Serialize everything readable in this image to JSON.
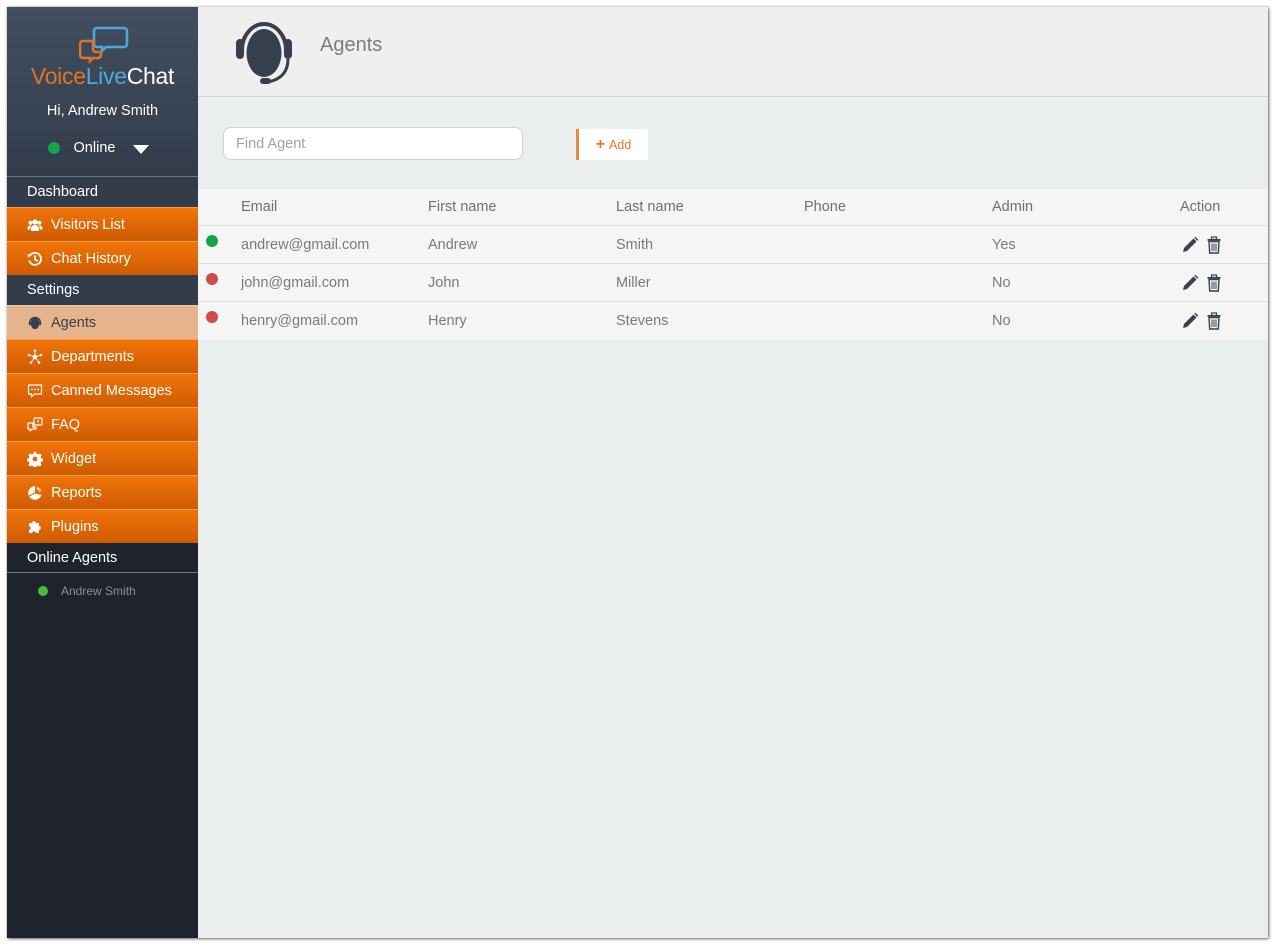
{
  "sidebar": {
    "brand": {
      "part1": "Voice",
      "part2": "Live",
      "part3": "Chat"
    },
    "greeting": "Hi, Andrew Smith",
    "status": {
      "label": "Online",
      "color": "#16a34a"
    },
    "sections": {
      "dashboard": "Dashboard",
      "settings": "Settings",
      "online_agents": "Online Agents"
    },
    "dashboard_items": [
      {
        "label": "Visitors List",
        "icon": "users-icon"
      },
      {
        "label": "Chat History",
        "icon": "history-icon"
      }
    ],
    "settings_items": [
      {
        "label": "Agents",
        "icon": "headset-icon",
        "active": true
      },
      {
        "label": "Departments",
        "icon": "network-icon"
      },
      {
        "label": "Canned Messages",
        "icon": "chat-dots-icon"
      },
      {
        "label": "FAQ",
        "icon": "faq-icon"
      },
      {
        "label": "Widget",
        "icon": "gear-icon"
      },
      {
        "label": "Reports",
        "icon": "pie-chart-icon"
      },
      {
        "label": "Plugins",
        "icon": "puzzle-icon"
      }
    ],
    "online_agents": [
      {
        "name": "Andrew Smith",
        "status_color": "#4cb83a"
      }
    ]
  },
  "header": {
    "title": "Agents",
    "icon": "headset-icon"
  },
  "toolbar": {
    "search_placeholder": "Find Agent",
    "search_value": "",
    "add_label": "Add"
  },
  "table": {
    "columns": [
      "Email",
      "First name",
      "Last name",
      "Phone",
      "Admin",
      "Action"
    ],
    "rows": [
      {
        "status": "online",
        "status_color": "#16a34a",
        "email": "andrew@gmail.com",
        "first_name": "Andrew",
        "last_name": "Smith",
        "phone": "",
        "admin": "Yes"
      },
      {
        "status": "offline",
        "status_color": "#cc4b4f",
        "email": "john@gmail.com",
        "first_name": "John",
        "last_name": "Miller",
        "phone": "",
        "admin": "No"
      },
      {
        "status": "offline",
        "status_color": "#cc4b4f",
        "email": "henry@gmail.com",
        "first_name": "Henry",
        "last_name": "Stevens",
        "phone": "",
        "admin": "No"
      }
    ]
  },
  "colors": {
    "accent_orange": "#f07409",
    "active_item": "#e5b48c",
    "sidebar_dark": "#1f232b",
    "icon_dark": "#36404f"
  }
}
